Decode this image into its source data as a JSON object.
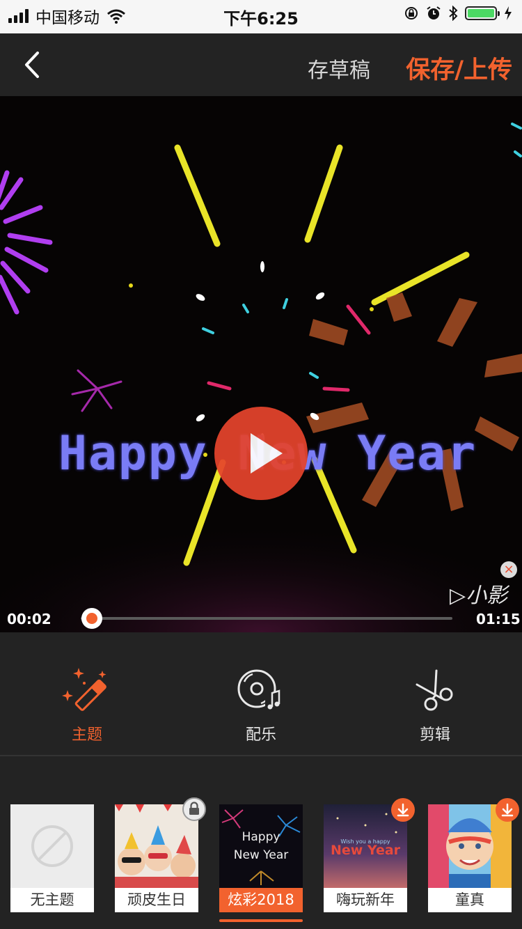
{
  "status_bar": {
    "carrier": "中国移动",
    "time": "下午6:25"
  },
  "nav": {
    "draft_label": "存草稿",
    "save_label": "保存/上传"
  },
  "video": {
    "overlay_text": "Happy New Year",
    "watermark": "▷小影",
    "current_time": "00:02",
    "total_time": "01:15",
    "progress": 0.03
  },
  "tools": [
    {
      "label": "主题",
      "icon": "magic-wand-icon",
      "active": true
    },
    {
      "label": "配乐",
      "icon": "music-disc-icon",
      "active": false
    },
    {
      "label": "剪辑",
      "icon": "scissors-icon",
      "active": false
    }
  ],
  "themes": [
    {
      "label": "无主题",
      "badge": "none"
    },
    {
      "label": "顽皮生日",
      "badge": "lock-icon"
    },
    {
      "label": "炫彩2018",
      "badge": "none",
      "selected": true,
      "thumb_text1": "Happy",
      "thumb_text2": "New Year"
    },
    {
      "label": "嗨玩新年",
      "badge": "download-icon",
      "thumb_text1": "Wish you a happy",
      "thumb_text2": "New Year"
    },
    {
      "label": "童真",
      "badge": "download-icon"
    }
  ],
  "colors": {
    "accent": "#f2622e",
    "background": "#232323"
  }
}
